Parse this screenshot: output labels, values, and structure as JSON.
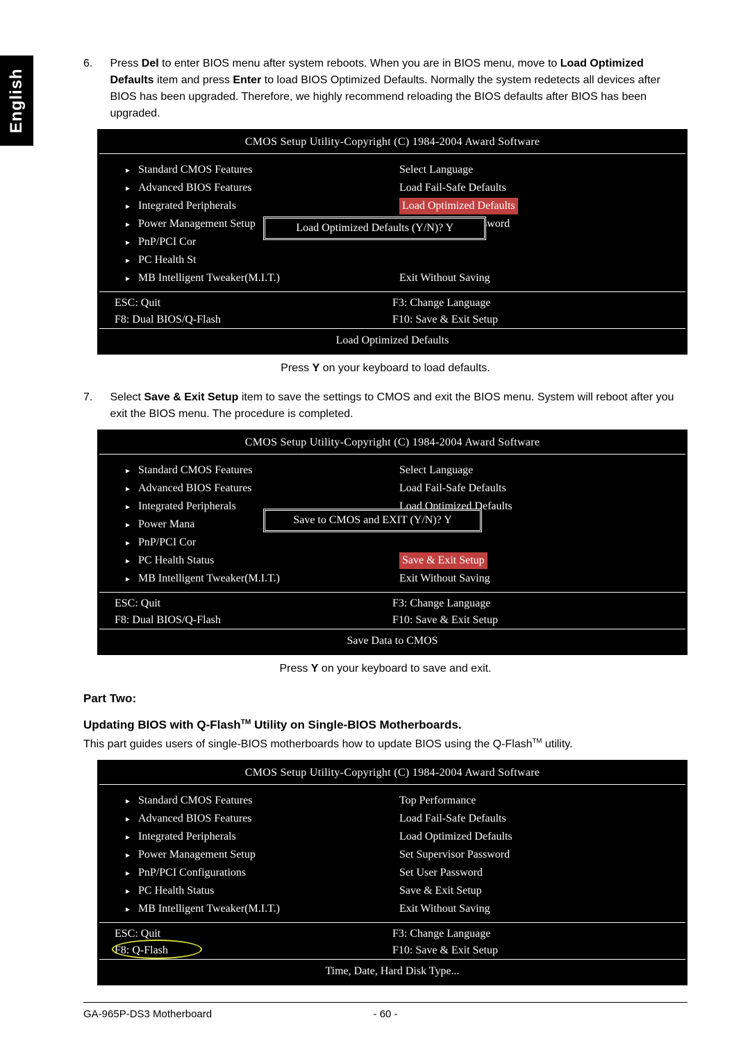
{
  "side_tab": "English",
  "steps": {
    "s6": {
      "num": "6.",
      "t1": "Press ",
      "t2": "Del",
      "t3": " to enter BIOS menu after system reboots. When you are in BIOS menu, move to",
      "t4": "Load Optimized Defaults",
      "t5": " item and press ",
      "t6": "Enter",
      "t7": " to load BIOS Optimized Defaults. Normally the system redetects all devices after BIOS has been upgraded. Therefore, we highly recommend reloading the BIOS defaults after BIOS has been upgraded."
    },
    "s7": {
      "num": "7.",
      "t1": "Select ",
      "t2": "Save & Exit Setup",
      "t3": " item to save the settings to CMOS and exit the BIOS menu. System will reboot after you exit the BIOS menu. The procedure is completed."
    }
  },
  "bios_title": "CMOS Setup Utility-Copyright (C) 1984-2004 Award Software",
  "bios1": {
    "left": [
      "Standard CMOS Features",
      "Advanced BIOS Features",
      "Integrated Peripherals",
      "Power Management Setup",
      "PnP/PCI Cor",
      "PC Health St",
      "MB Intelligent Tweaker(M.I.T.)"
    ],
    "right": [
      "Select Language",
      "Load Fail-Safe Defaults",
      "Load Optimized Defaults",
      "Set Supervisor Password",
      "",
      "",
      "Exit Without Saving"
    ],
    "highlight_idx": 2,
    "dialog": "Load Optimized Defaults (Y/N)? Y",
    "footer_l1": "ESC: Quit",
    "footer_r1": "F3: Change Language",
    "footer_l2": "F8: Dual BIOS/Q-Flash",
    "footer_r2": "F10: Save & Exit Setup",
    "footer_help": "Load Optimized Defaults"
  },
  "caption1a": "Press ",
  "caption1b": "Y",
  "caption1c": " on your keyboard to load defaults.",
  "bios2": {
    "left": [
      "Standard CMOS Features",
      "Advanced BIOS Features",
      "Integrated Peripherals",
      "Power Mana",
      "PnP/PCI Cor",
      "PC Health Status",
      "MB Intelligent Tweaker(M.I.T.)"
    ],
    "right": [
      "Select Language",
      "Load Fail-Safe Defaults",
      "Load Optimized Defaults",
      "",
      "",
      "Save & Exit Setup",
      "Exit Without Saving"
    ],
    "highlight_idx": 5,
    "dialog": "Save to CMOS and EXIT (Y/N)? Y",
    "footer_l1": "ESC: Quit",
    "footer_r1": "F3: Change Language",
    "footer_l2": "F8: Dual BIOS/Q-Flash",
    "footer_r2": "F10: Save & Exit Setup",
    "footer_help": "Save Data to CMOS"
  },
  "caption2a": "Press ",
  "caption2b": "Y",
  "caption2c": " on your keyboard to save and exit.",
  "part2": {
    "heading": "Part Two:",
    "sub_a": "Updating BIOS with Q-Flash",
    "sub_b": " Utility on Single-BIOS Motherboards.",
    "body_a": "This part guides users of single-BIOS motherboards how to update BIOS using the Q-Flash",
    "body_b": " utility."
  },
  "bios3": {
    "left": [
      "Standard CMOS Features",
      "Advanced BIOS Features",
      "Integrated Peripherals",
      "Power Management Setup",
      "PnP/PCI Configurations",
      "PC Health Status",
      "MB Intelligent Tweaker(M.I.T.)"
    ],
    "right": [
      "Top Performance",
      "Load Fail-Safe Defaults",
      "Load Optimized Defaults",
      "Set Supervisor Password",
      "Set User Password",
      "Save & Exit Setup",
      "Exit Without Saving"
    ],
    "footer_l1": "ESC: Quit",
    "footer_r1": "F3: Change Language",
    "footer_l2": "F8: Q-Flash",
    "footer_r2": "F10: Save & Exit Setup",
    "footer_help": "Time, Date, Hard Disk Type..."
  },
  "footer_mb": "GA-965P-DS3 Motherboard",
  "footer_pg": "- 60 -"
}
